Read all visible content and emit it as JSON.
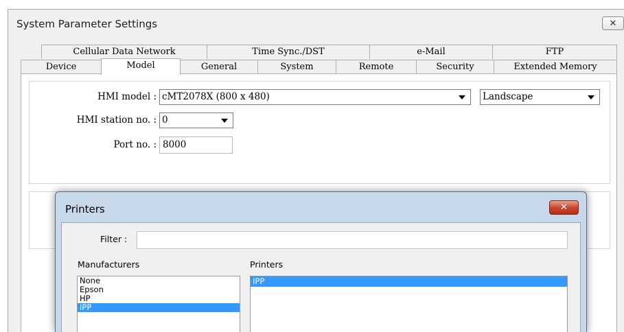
{
  "window": {
    "title": "System Parameter Settings",
    "close_symbol": "✕"
  },
  "tabs_row1": [
    "Cellular Data Network",
    "Time Sync./DST",
    "e-Mail",
    "FTP"
  ],
  "tabs_row2": [
    "Device",
    "Model",
    "General",
    "System",
    "Remote",
    "Security",
    "Extended Memory"
  ],
  "active_tab": "Model",
  "model": {
    "hmi_model_label": "HMI model :",
    "hmi_model_value": "cMT2078X (800 x 480)",
    "orientation_value": "Landscape",
    "station_label": "HMI station no. :",
    "station_value": "0",
    "port_label": "Port no. :",
    "port_value": "8000"
  },
  "printers_dialog": {
    "title": "Printers",
    "close_symbol": "✕",
    "filter_label": "Filter :",
    "filter_value": "",
    "manufacturers_label": "Manufacturers",
    "manufacturers": [
      "None",
      "Epson",
      "HP",
      "IPP"
    ],
    "selected_manufacturer": "IPP",
    "printers_label": "Printers",
    "printers": [
      "IPP"
    ],
    "selected_printer": "IPP"
  },
  "colors": {
    "selection": "#3399ff",
    "dialog_frame": "#c6d8ea",
    "close_red": "#c7432a"
  }
}
